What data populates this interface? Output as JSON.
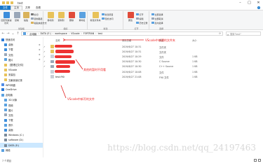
{
  "window": {
    "title": "test",
    "controls": {
      "minimize": "–",
      "maximize": "□",
      "close": "✕"
    }
  },
  "tabs": {
    "file": "文件",
    "home": "主页",
    "share": "共享",
    "view": "查看"
  },
  "ribbon": {
    "groups": {
      "clipboard": "剪贴板",
      "organize": "组织",
      "new": "新建",
      "open": "打开",
      "select": "选择"
    },
    "pin": "固定到快速访问",
    "copy": "复制",
    "paste": "粘贴",
    "cut": "剪切",
    "copy_path": "复制路径",
    "paste_shortcut": "粘贴快捷方式",
    "move_to": "移动到",
    "copy_to": "复制到",
    "delete": "删除",
    "rename": "重命名",
    "new_folder": "新建文件夹",
    "new_item": "新建项目",
    "easy_access": "轻松访问",
    "properties": "属性",
    "open_btn": "打开",
    "edit": "编辑",
    "history": "历史记录",
    "select_all": "全部选择",
    "select_none": "全部取消",
    "invert": "反向选择"
  },
  "address": {
    "segments": [
      "此电脑",
      "DATA (E:)",
      "workspace",
      "VScode",
      "FORTRAN",
      "test"
    ],
    "search_placeholder": "搜索\"test\""
  },
  "navpane": {
    "items": [
      {
        "label": "快速访问",
        "color": "#2b79d6"
      },
      {
        "label": "桌面",
        "color": "#3c8ddb",
        "pinned": true
      },
      {
        "label": "下载",
        "color": "#3c8ddb",
        "pinned": true
      },
      {
        "label": "文档",
        "color": "#9aa7b8",
        "pinned": true
      },
      {
        "label": "图片",
        "color": "#5aa1e0",
        "pinned": true
      },
      {
        "label": "【整理过文件】",
        "color": "#e8c25a"
      },
      {
        "label": "VScode",
        "color": "#e8c25a"
      },
      {
        "label": "安装包",
        "color": "#e8c25a"
      },
      {
        "label": "文献阅读记录",
        "color": "#e8c25a"
      },
      {
        "label": "WPS网盘",
        "color": "#4f8be6"
      },
      {
        "label": "OneDrive",
        "color": "#2b79d6"
      },
      {
        "label": "此电脑",
        "color": "#5aa1e0"
      },
      {
        "label": "3D 对象",
        "color": "#5aa1e0"
      },
      {
        "label": "视频",
        "color": "#5aa1e0"
      },
      {
        "label": "图片",
        "color": "#5aa1e0"
      },
      {
        "label": "文档",
        "color": "#9aa7b8"
      },
      {
        "label": "下载",
        "color": "#3c8ddb"
      },
      {
        "label": "音乐",
        "color": "#5aa1e0"
      },
      {
        "label": "桌面",
        "color": "#3c8ddb"
      },
      {
        "label": "Windows (C:)",
        "color": "#7a8a9a"
      },
      {
        "label": "software (D:)",
        "color": "#7a8a9a"
      },
      {
        "label": "DATA (E:)",
        "color": "#7a8a9a"
      },
      {
        "label": "网络",
        "color": "#5aa1e0"
      }
    ]
  },
  "columns": {
    "name": "名称",
    "modified": "修改日期",
    "type": "类型",
    "size": "大小"
  },
  "files": [
    {
      "name": "",
      "modified": "2019/6/27 10:31",
      "type": "文件夹",
      "size": "",
      "color": "#e8c25a"
    },
    {
      "name": "",
      "modified": "2019/6/27 10:31",
      "type": "文件夹",
      "size": "",
      "color": "#e8c25a"
    },
    {
      "name": "",
      "modified": "2019/6/27 10:29",
      "type": "文件",
      "size": "1 KB",
      "color": "#c9ced6"
    },
    {
      "name": "",
      "modified": "2019/6/27 10:30",
      "type": "C Source",
      "size": "1 KB",
      "color": "#9aa7b8"
    },
    {
      "name": "",
      "modified": "2019/6/27 10:30",
      "type": "C++ Source",
      "size": "1 KB",
      "color": "#9aa7b8"
    },
    {
      "name": "",
      "modified": "2019/6/27 10:08",
      "type": "文件",
      "size": "1 KB",
      "color": "#c9ced6"
    },
    {
      "name": "test.f90",
      "modified": "2019/6/27 21:08",
      "type": "F90 文件",
      "size": "1 KB",
      "color": "#c9ced6"
    }
  ],
  "status": {
    "count": "7 个项目"
  },
  "annotations": {
    "folder": "VScode中新建的文件夹",
    "other": "其他的暂时不用看",
    "file": "VScode中新写的文件"
  },
  "watermark": "https://blog.csdn.net/qq_24197463",
  "colors": {
    "accent": "#1979ca",
    "annotation": "#e22222"
  }
}
